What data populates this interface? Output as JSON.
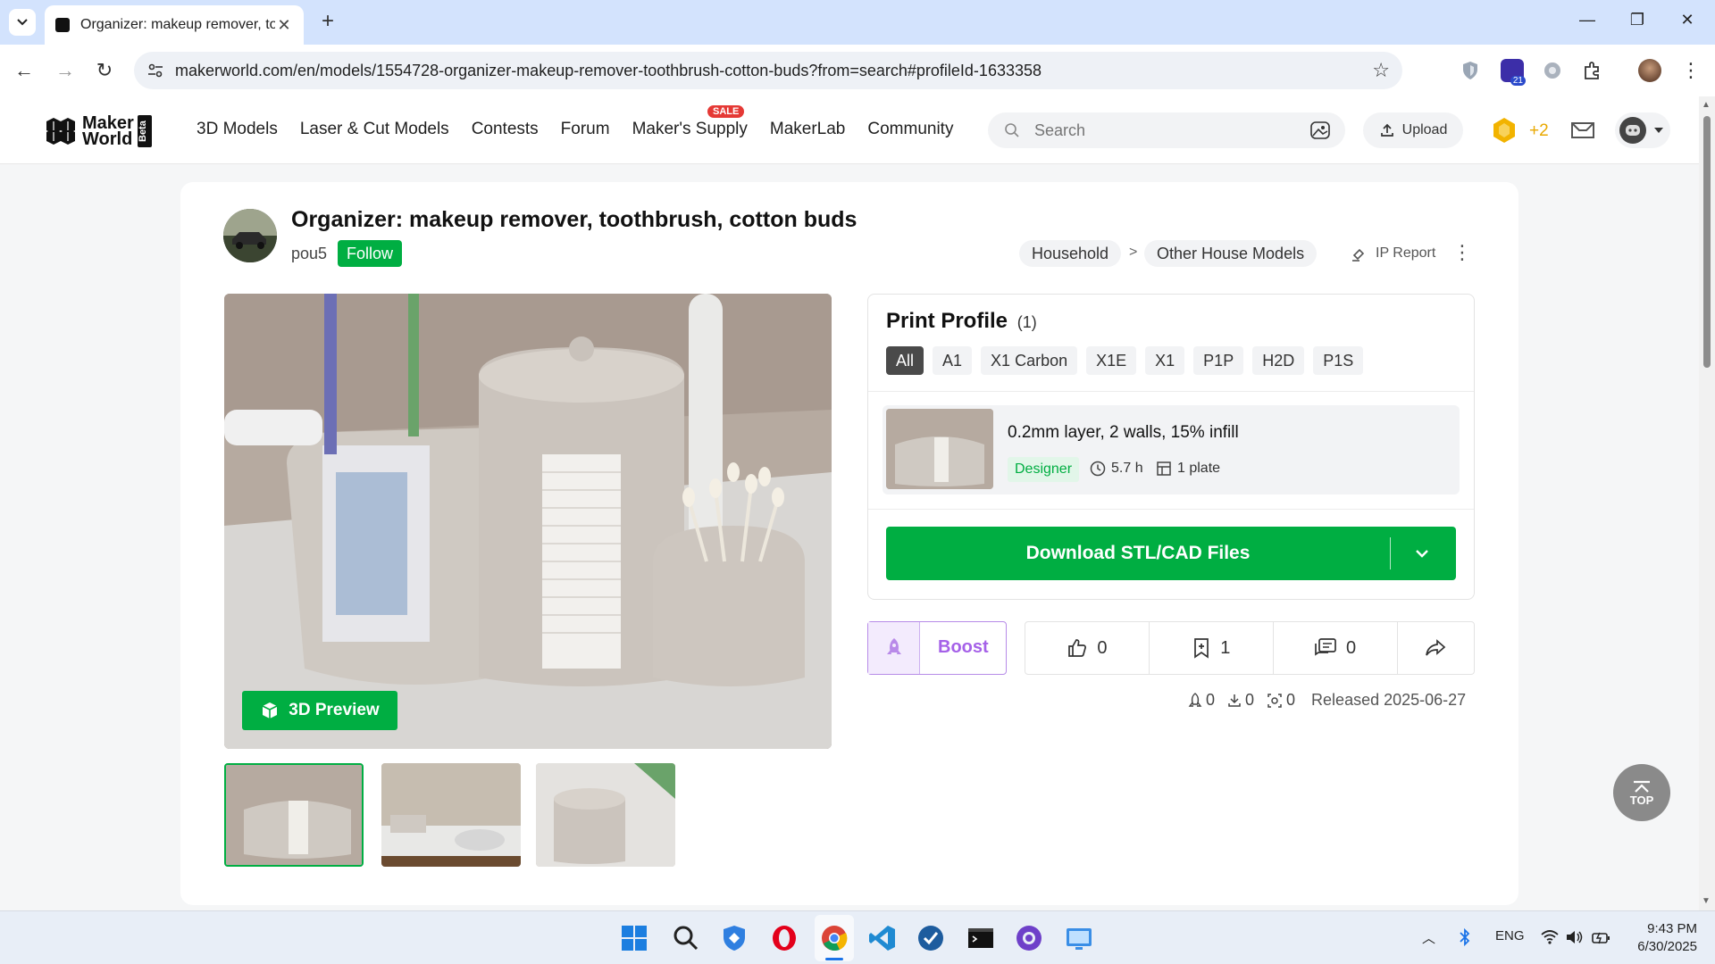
{
  "browser": {
    "tab_title": "Organizer: makeup remover, to",
    "url": "makerworld.com/en/models/1554728-organizer-makeup-remover-toothbrush-cotton-buds?from=search#profileId-1633358",
    "extension_badge": "21"
  },
  "site": {
    "logo_line1": "Maker",
    "logo_line2": "World",
    "logo_beta": "Beta",
    "nav": [
      "3D Models",
      "Laser & Cut Models",
      "Contests",
      "Forum",
      "Maker's Supply",
      "MakerLab",
      "Community"
    ],
    "sale_badge": "SALE",
    "search_placeholder": "Search",
    "upload_label": "Upload",
    "points": "+2"
  },
  "model": {
    "title": "Organizer: makeup remover, toothbrush, cotton buds",
    "author": "pou5",
    "follow_label": "Follow",
    "breadcrumb": [
      "Household",
      ">",
      "Other House Models"
    ],
    "ip_report": "IP Report",
    "preview_label": "3D Preview"
  },
  "print_profile": {
    "title": "Print Profile",
    "count": "(1)",
    "filters": [
      "All",
      "A1",
      "X1 Carbon",
      "X1E",
      "X1",
      "P1P",
      "H2D",
      "P1S"
    ],
    "active_filter": "All",
    "profile": {
      "name": "0.2mm layer, 2 walls, 15% infill",
      "badge": "Designer",
      "time": "5.7 h",
      "plates": "1 plate"
    },
    "download_label": "Download STL/CAD Files"
  },
  "actions": {
    "boost_label": "Boost",
    "likes": "0",
    "collects": "1",
    "comments": "0"
  },
  "footer_stats": {
    "boosts": "0",
    "downloads": "0",
    "prints": "0",
    "released": "Released 2025-06-27"
  },
  "top_button": "TOP",
  "taskbar": {
    "lang": "ENG",
    "time": "9:43 PM",
    "date": "6/30/2025"
  },
  "colors": {
    "brand_green": "#00ae42",
    "boost_purple": "#a561e8",
    "coin_gold": "#f2b300"
  }
}
